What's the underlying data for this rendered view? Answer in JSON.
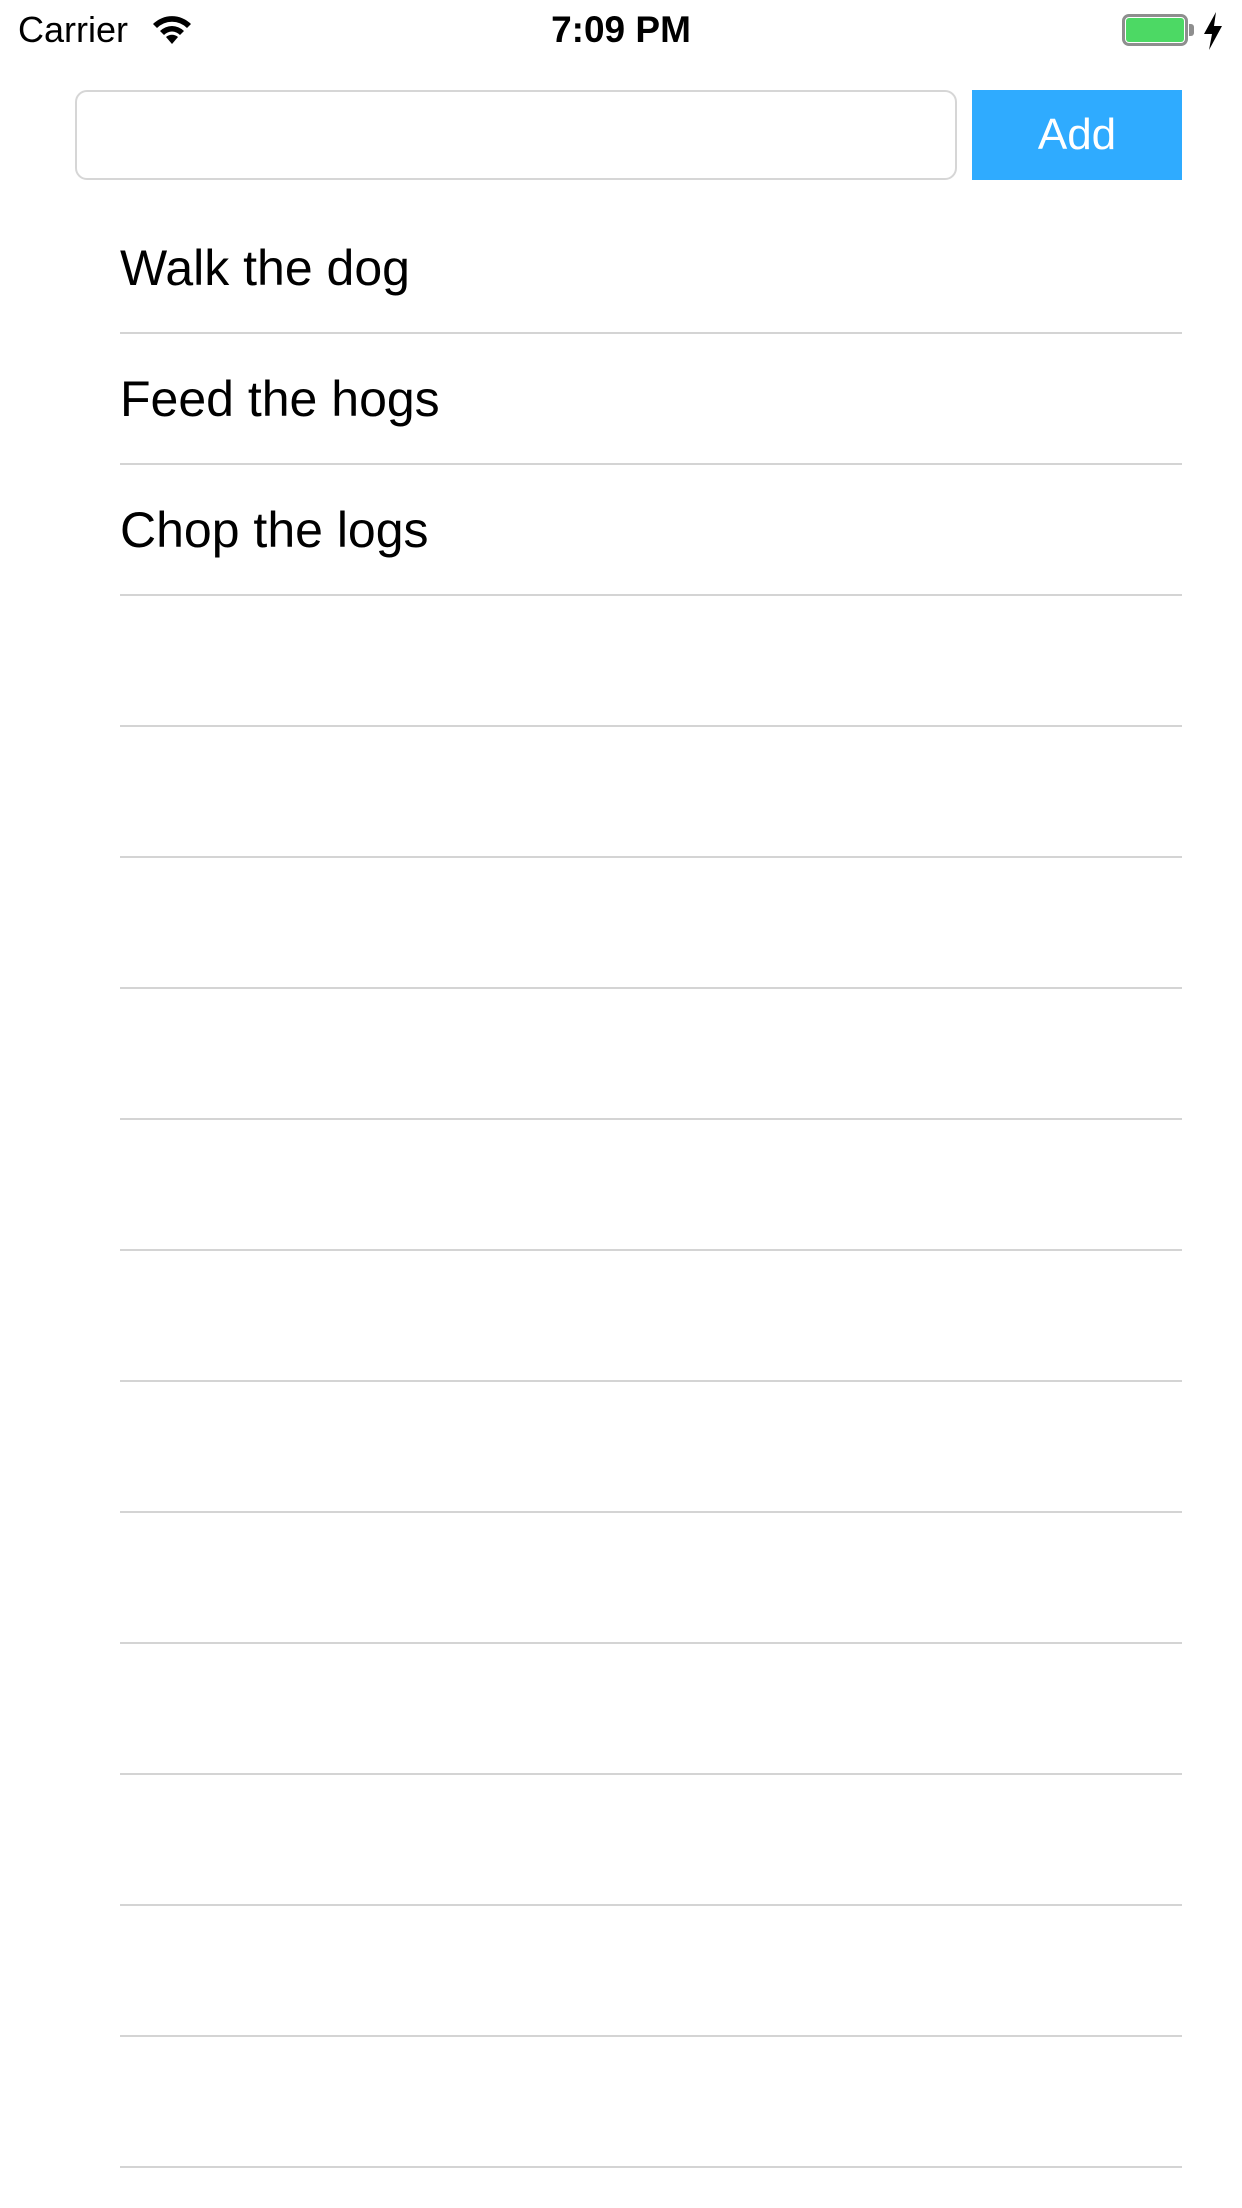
{
  "status_bar": {
    "carrier": "Carrier",
    "time": "7:09 PM",
    "battery_level": 1.0,
    "charging": true
  },
  "input": {
    "value": "",
    "placeholder": ""
  },
  "add_button": {
    "label": "Add",
    "color": "#2fabff"
  },
  "tasks": [
    {
      "label": "Walk the dog"
    },
    {
      "label": "Feed the hogs"
    },
    {
      "label": "Chop the logs"
    },
    {
      "label": ""
    },
    {
      "label": ""
    },
    {
      "label": ""
    },
    {
      "label": ""
    },
    {
      "label": ""
    },
    {
      "label": ""
    },
    {
      "label": ""
    },
    {
      "label": ""
    },
    {
      "label": ""
    },
    {
      "label": ""
    },
    {
      "label": ""
    },
    {
      "label": ""
    }
  ],
  "icons": {
    "wifi": "wifi-icon",
    "battery": "battery-icon",
    "charging": "lightning-bolt-icon"
  }
}
